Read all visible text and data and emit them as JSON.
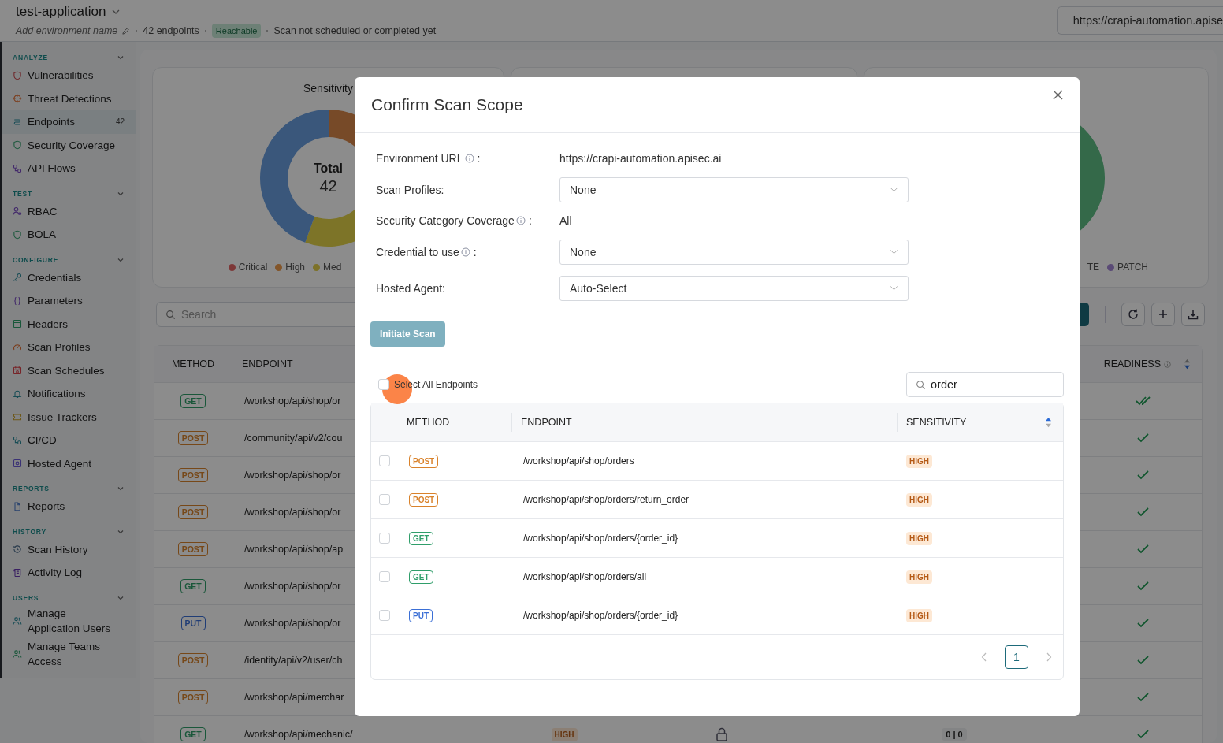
{
  "header": {
    "title": "test-application",
    "environment_placeholder": "Add environment name",
    "endpoint_count": "42 endpoints",
    "status": "Reachable",
    "scan_status": "Scan not scheduled or completed yet",
    "url": "https://crapi-automation.apise"
  },
  "sidebar": {
    "sections": [
      {
        "title": "ANALYZE",
        "expanded": true,
        "items": [
          {
            "label": "Vulnerabilities",
            "selected": false
          },
          {
            "label": "Threat Detections",
            "selected": false
          },
          {
            "label": "Endpoints",
            "selected": true,
            "count": "42"
          },
          {
            "label": "Security Coverage",
            "selected": false
          },
          {
            "label": "API Flows",
            "selected": false
          }
        ]
      },
      {
        "title": "TEST",
        "expanded": true,
        "items": [
          {
            "label": "RBAC",
            "selected": false
          },
          {
            "label": "BOLA",
            "selected": false
          }
        ]
      },
      {
        "title": "CONFIGURE",
        "expanded": true,
        "items": [
          {
            "label": "Credentials",
            "selected": false
          },
          {
            "label": "Parameters",
            "selected": false
          },
          {
            "label": "Headers",
            "selected": false
          },
          {
            "label": "Scan Profiles",
            "selected": false
          },
          {
            "label": "Scan Schedules",
            "selected": false
          },
          {
            "label": "Notifications",
            "selected": false
          },
          {
            "label": "Issue Trackers",
            "selected": false
          },
          {
            "label": "CI/CD",
            "selected": false
          },
          {
            "label": "Hosted Agent",
            "selected": false
          }
        ]
      },
      {
        "title": "REPORTS",
        "expanded": true,
        "items": [
          {
            "label": "Reports",
            "selected": false
          }
        ]
      },
      {
        "title": "HISTORY",
        "expanded": true,
        "items": [
          {
            "label": "Scan History",
            "selected": false
          },
          {
            "label": "Activity Log",
            "selected": false
          }
        ]
      },
      {
        "title": "USERS",
        "expanded": true,
        "items": [
          {
            "label": "Manage Application Users",
            "selected": false
          },
          {
            "label": "Manage Teams Access",
            "selected": false
          }
        ]
      }
    ]
  },
  "charts": [
    {
      "title": "Sensitivity",
      "center_label": "Total",
      "center_value": "42",
      "legend": [
        {
          "label": "Critical",
          "color": "#7d3737"
        },
        {
          "label": "High",
          "color": "#835529"
        },
        {
          "label": "Med",
          "color": "#7d7229"
        }
      ]
    },
    {
      "legend": [
        {
          "label": "TE"
        },
        {
          "label": "PATCH",
          "color": "#5a4a76"
        }
      ]
    }
  ],
  "toolbar": {
    "search_placeholder": "Search"
  },
  "table": {
    "columns": [
      "METHOD",
      "ENDPOINT",
      "READINESS"
    ],
    "rows": [
      {
        "method": {
          "label": "GET",
          "color": "#1a573a"
        },
        "endpoint": "/workshop/api/shop/or",
        "double_check": true
      },
      {
        "method": {
          "label": "POST",
          "color": "#774818"
        },
        "endpoint": "/community/api/v2/cou",
        "double_check": false
      },
      {
        "method": {
          "label": "POST",
          "color": "#774818"
        },
        "endpoint": "/workshop/api/shop/or",
        "double_check": false
      },
      {
        "method": {
          "label": "POST",
          "color": "#774818"
        },
        "endpoint": "/workshop/api/shop/or",
        "double_check": false
      },
      {
        "method": {
          "label": "POST",
          "color": "#774818"
        },
        "endpoint": "/workshop/api/shop/ap",
        "double_check": false
      },
      {
        "method": {
          "label": "GET",
          "color": "#1a573a"
        },
        "endpoint": "/workshop/api/shop/or",
        "double_check": false
      },
      {
        "method": {
          "label": "PUT",
          "color": "#203d76"
        },
        "endpoint": "/workshop/api/shop/or",
        "double_check": false
      },
      {
        "method": {
          "label": "POST",
          "color": "#774818"
        },
        "endpoint": "/identity/api/v2/user/ch",
        "double_check": false
      },
      {
        "method": {
          "label": "POST",
          "color": "#774818"
        },
        "endpoint": "/workshop/api/merchar",
        "double_check": false
      },
      {
        "method": {
          "label": "GET",
          "color": "#1a573a"
        },
        "endpoint": "/workshop/api/mechanic/",
        "double_check": false,
        "sensitivity": "HIGH",
        "locked": true,
        "counts": "0 | 0"
      }
    ]
  },
  "modal": {
    "title": "Confirm Scan Scope",
    "fields": [
      {
        "label": "Environment URL",
        "info": true,
        "colon": ":",
        "kind": "text",
        "value": "https://crapi-automation.apisec.ai"
      },
      {
        "label": "Scan Profiles:",
        "info": false,
        "kind": "select",
        "value": "None"
      },
      {
        "label": "Security Category Coverage",
        "info": true,
        "colon": ":",
        "kind": "text",
        "value": "All"
      },
      {
        "label": "Credential to use",
        "info": true,
        "colon": ":",
        "kind": "select",
        "value": "None"
      },
      {
        "label": "Hosted Agent:",
        "info": false,
        "kind": "select",
        "value": "Auto-Select"
      }
    ],
    "primary_button": {
      "label": "Initiate Scan",
      "disabled": true
    },
    "select_all": {
      "label": "Select All Endpoints",
      "checked": false
    },
    "search": {
      "value": "order"
    },
    "table": {
      "columns": [
        "METHOD",
        "ENDPOINT",
        "SENSITIVITY"
      ],
      "rows": [
        {
          "checked": false,
          "method": {
            "label": "POST",
            "color": "#d9822b"
          },
          "endpoint": "/workshop/api/shop/orders",
          "sensitivity": "HIGH"
        },
        {
          "checked": false,
          "method": {
            "label": "POST",
            "color": "#d9822b"
          },
          "endpoint": "/workshop/api/shop/orders/return_order",
          "sensitivity": "HIGH"
        },
        {
          "checked": false,
          "method": {
            "label": "GET",
            "color": "#2f9e6a"
          },
          "endpoint": "/workshop/api/shop/orders/{order_id}",
          "sensitivity": "HIGH"
        },
        {
          "checked": false,
          "method": {
            "label": "GET",
            "color": "#2f9e6a"
          },
          "endpoint": "/workshop/api/shop/orders/all",
          "sensitivity": "HIGH"
        },
        {
          "checked": false,
          "method": {
            "label": "PUT",
            "color": "#3b6fd6"
          },
          "endpoint": "/workshop/api/shop/orders/{order_id}",
          "sensitivity": "HIGH"
        }
      ]
    },
    "pagination": {
      "pages": [
        {
          "label": "1",
          "selected": true
        }
      ]
    }
  }
}
